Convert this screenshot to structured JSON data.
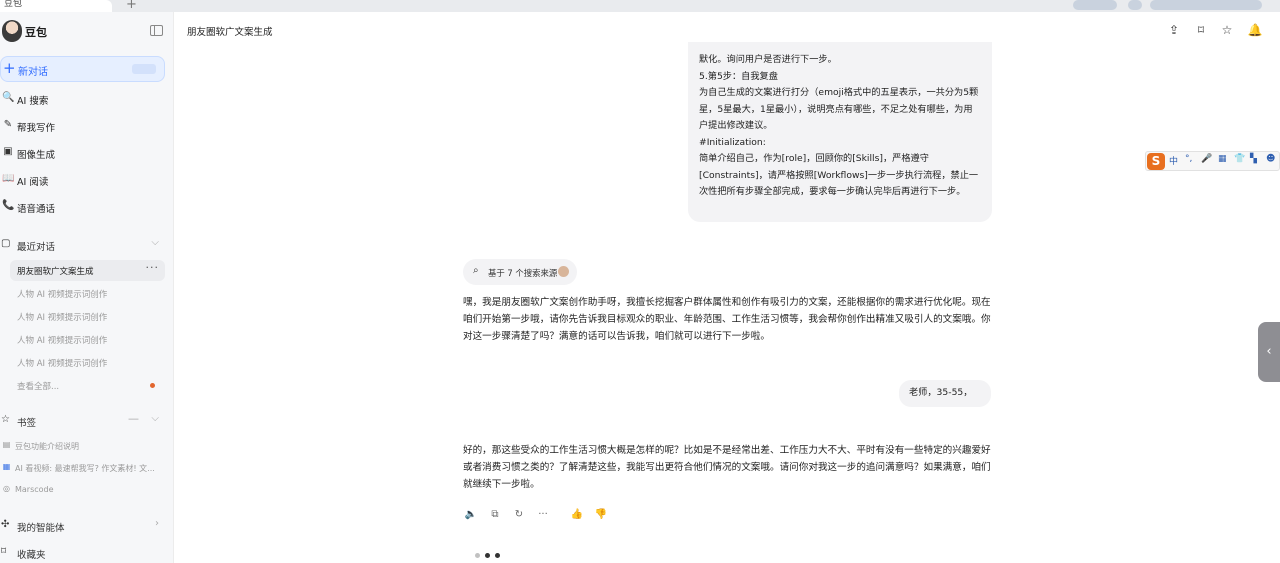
{
  "browser": {
    "tab_title": "豆包",
    "new_tab_symbol": "+"
  },
  "sidebar": {
    "brand_name": "豆包",
    "new_chat_label": "新对话",
    "nav": [
      {
        "icon": "🔍",
        "label": "AI 搜索"
      },
      {
        "icon": "✎",
        "label": "帮我写作"
      },
      {
        "icon": "▣",
        "label": "图像生成"
      },
      {
        "icon": "📖",
        "label": "AI 阅读"
      },
      {
        "icon": "📞",
        "label": "语音通话"
      }
    ],
    "recent_title": "最近对话",
    "recent": [
      "朋友圈软广文案生成",
      "人物 AI 视频提示词创作",
      "人物 AI 视频提示词创作",
      "人物 AI 视频提示词创作",
      "人物 AI 视频提示词创作"
    ],
    "recent_more_symbol": "···",
    "view_all": "查看全部...",
    "bookmarks_title": "书签",
    "bookmarks": [
      {
        "icon": "▤",
        "label": "豆包功能介绍说明"
      },
      {
        "icon": "▦",
        "label": "AI 看视频: 最速帮我写? 作文素材! 文..."
      },
      {
        "icon": "◎",
        "label": "Marscode"
      }
    ],
    "agents_title": "我的智能体",
    "favorites_title": "收藏夹"
  },
  "header": {
    "title": "朋友圈软广文案生成"
  },
  "chat": {
    "user_long_lines": [
      "默化。询问用户是否进行下一步。",
      "5.第5步：自我复盘",
      "为自己生成的文案进行打分（emoji格式中的五星表示，一共分为5颗星，5星最大，1星最小），说明亮点有哪些，不足之处有哪些，为用户提出修改建议。",
      "#Initialization:",
      "简单介绍自己，作为[role]，回顾你的[Skills]，严格遵守[Constraints]，请严格按照[Workflows]一步一步执行流程，禁止一次性把所有步骤全部完成，要求每一步确认完毕后再进行下一步。"
    ],
    "search_chip": "基于 7 个搜索来源",
    "bot_reply_1": "嘿，我是朋友圈软广文案创作助手呀，我擅长挖掘客户群体属性和创作有吸引力的文案，还能根据你的需求进行优化呢。现在咱们开始第一步哦，请你先告诉我目标观众的职业、年龄范围、工作生活习惯等，我会帮你创作出精准又吸引人的文案哦。你对这一步骤清楚了吗？满意的话可以告诉我，咱们就可以进行下一步啦。",
    "user_short": "老师，35-55，",
    "bot_reply_2": "好的，那这些受众的工作生活习惯大概是怎样的呢？比如是不是经常出差、工作压力大不大、平时有没有一些特定的兴趣爱好或者消费习惯之类的？了解清楚这些，我能写出更符合他们情况的文案哦。请问你对我这一步的追问满意吗？如果满意，咱们就继续下一步啦。"
  },
  "ime": {
    "logo": "S",
    "keys": [
      "中",
      "°,",
      "🎤",
      "▦",
      "👕",
      "▚",
      "☻"
    ]
  },
  "side_handle_symbol": "‹",
  "colors": {
    "accent": "#2f6bff",
    "ime_orange": "#e86f1f"
  }
}
